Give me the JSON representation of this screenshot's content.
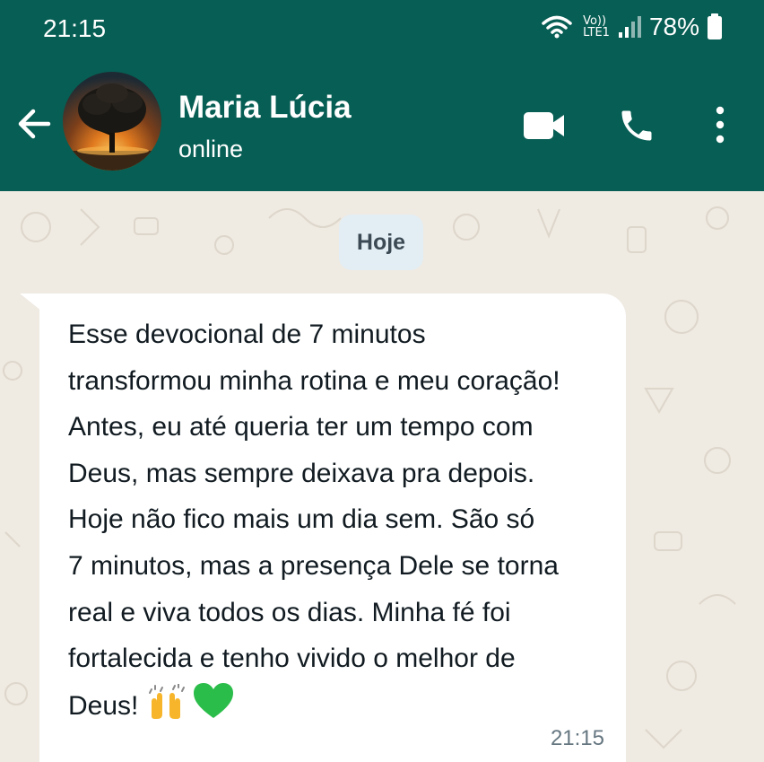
{
  "status_bar": {
    "time": "21:15",
    "volte_top": "Vo))",
    "volte_bottom": "LTE1",
    "battery": "78%"
  },
  "header": {
    "contact_name": "Maria Lúcia",
    "contact_status": "online",
    "icons": [
      "back-arrow-icon",
      "avatar",
      "video-call-icon",
      "phone-icon",
      "more-vert-icon"
    ]
  },
  "chat": {
    "date_chip": "Hoje",
    "message": {
      "lines": [
        "Esse devocional de 7 minutos",
        "transformou minha rotina e meu coração!",
        "Antes, eu até queria ter um tempo com",
        "Deus, mas sempre deixava pra depois.",
        "Hoje não fico mais um dia sem. São só",
        "7 minutos, mas a presença Dele se torna",
        "real e viva todos os dias. Minha fé foi",
        "fortalecida e tenho vivido o melhor de",
        "Deus!"
      ],
      "time": "21:15",
      "emojis": [
        "raising-hands-emoji",
        "green-heart-emoji"
      ]
    }
  },
  "colors": {
    "header": "#075e54",
    "chat_background": "#efeae2",
    "bubble": "#ffffff",
    "date_chip": "#e3eef4",
    "heart": "#2bbd4a",
    "hands": "#f7b52c"
  }
}
